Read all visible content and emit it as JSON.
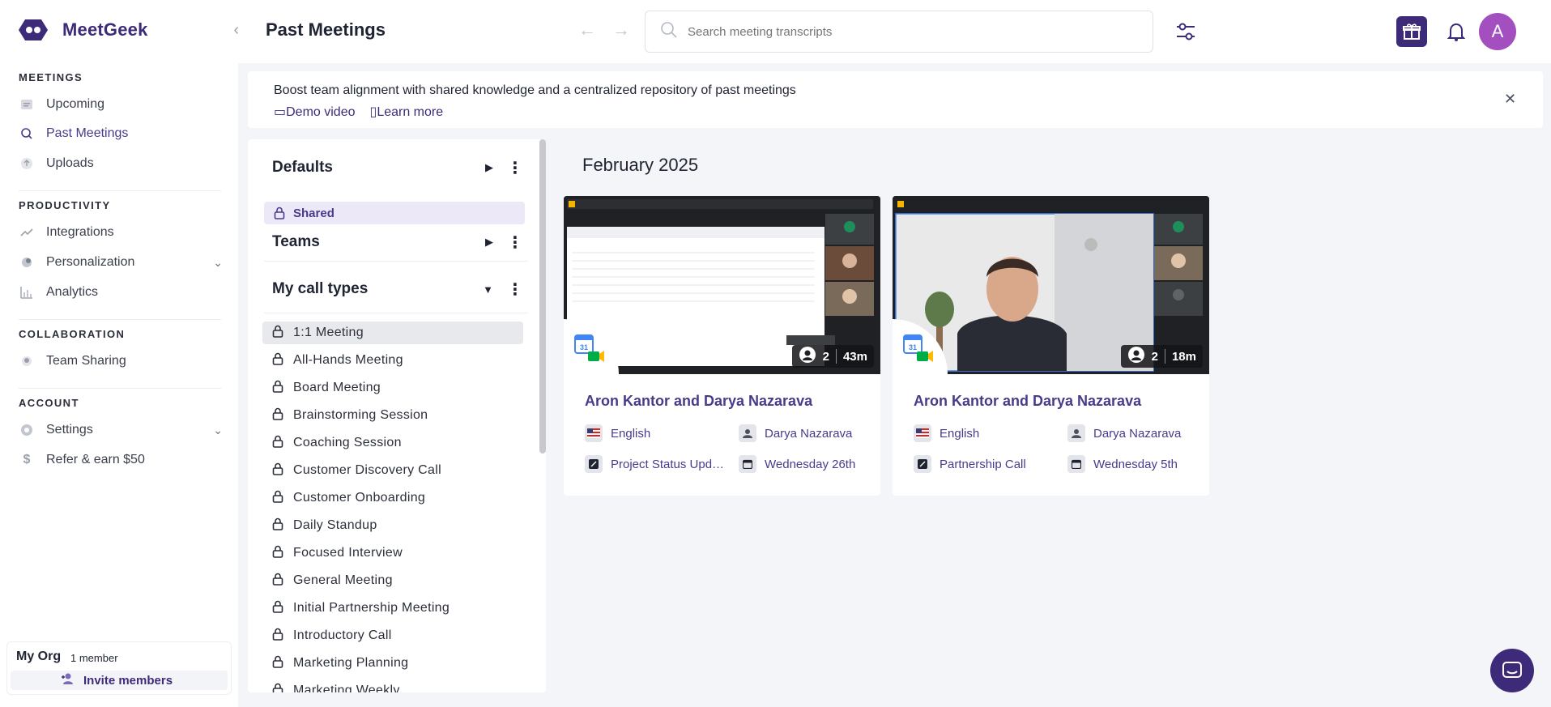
{
  "app": {
    "name": "MeetGeek",
    "brand_color": "#3d2b7a",
    "accent_color": "#a44fbf"
  },
  "sidebar": {
    "sections": [
      {
        "title": "MEETINGS",
        "items": [
          {
            "label": "Upcoming",
            "icon": "calendar-list-icon"
          },
          {
            "label": "Past Meetings",
            "icon": "search-icon",
            "active": true
          },
          {
            "label": "Uploads",
            "icon": "upload-icon"
          }
        ]
      },
      {
        "title": "PRODUCTIVITY",
        "items": [
          {
            "label": "Integrations",
            "icon": "integrations-icon"
          },
          {
            "label": "Personalization",
            "icon": "personalization-icon",
            "expandable": true
          },
          {
            "label": "Analytics",
            "icon": "bar-chart-icon"
          }
        ]
      },
      {
        "title": "COLLABORATION",
        "items": [
          {
            "label": "Team Sharing",
            "icon": "team-icon"
          }
        ]
      },
      {
        "title": "ACCOUNT",
        "items": [
          {
            "label": "Settings",
            "icon": "gear-icon",
            "expandable": true
          },
          {
            "label": "Refer & earn $50",
            "icon": "dollar-icon"
          }
        ]
      }
    ],
    "org": {
      "name": "My Org",
      "members": "1 member",
      "invite_label": "Invite members"
    }
  },
  "header": {
    "title": "Past Meetings",
    "search_placeholder": "Search meeting transcripts",
    "avatar_initial": "A"
  },
  "banner": {
    "text": "Boost team alignment with shared knowledge and a centralized repository of past meetings",
    "demo_link": "Demo video",
    "learn_link": "Learn more"
  },
  "call_types": {
    "defaults_title": "Defaults",
    "shared_label": "Shared",
    "teams_title": "Teams",
    "my_title": "My call types",
    "items": [
      "1:1 Meeting",
      "All-Hands Meeting",
      "Board Meeting",
      "Brainstorming Session",
      "Coaching Session",
      "Customer Discovery Call",
      "Customer Onboarding",
      "Daily Standup",
      "Focused Interview",
      "General Meeting",
      "Initial Partnership Meeting",
      "Introductory Call",
      "Marketing Planning",
      "Marketing Weekly"
    ]
  },
  "content": {
    "month": "February 2025",
    "meetings": [
      {
        "title": "Aron Kantor and Darya Nazarava",
        "participants": "2",
        "duration": "43m",
        "language": "English",
        "host": "Darya Nazarava",
        "call_type": "Project Status Upd…",
        "date": "Wednesday 26th"
      },
      {
        "title": "Aron Kantor and Darya Nazarava",
        "participants": "2",
        "duration": "18m",
        "language": "English",
        "host": "Darya Nazarava",
        "call_type": "Partnership Call",
        "date": "Wednesday 5th"
      }
    ]
  }
}
